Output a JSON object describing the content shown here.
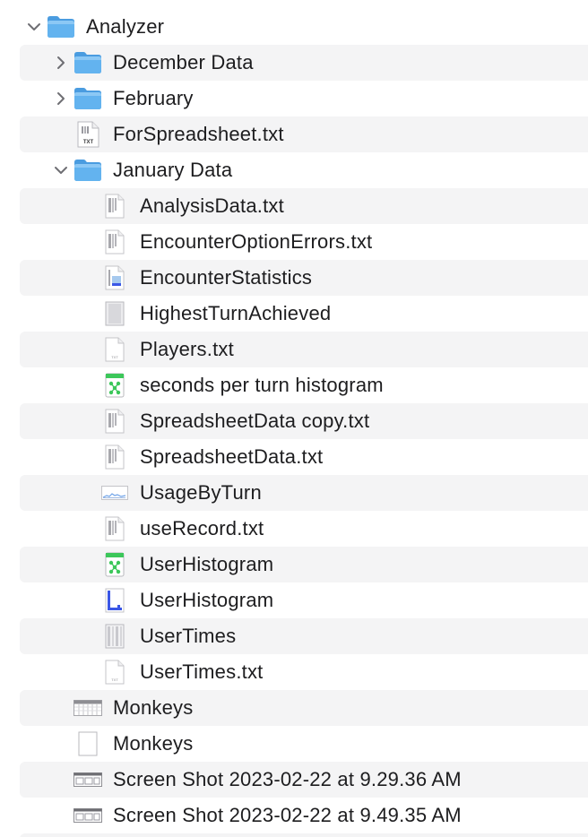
{
  "colors": {
    "folder": "#63b3ef",
    "folder_tab": "#4a9ce0",
    "stripe": "#f4f4f5",
    "text": "#1d1d1f",
    "chevron": "#6e6e73",
    "numbers_green": "#3cc75a",
    "chart_blue": "#3b57e6"
  },
  "items": [
    {
      "label": "Analyzer",
      "level": 0,
      "kind": "folder",
      "disclosure": "expanded",
      "icon": "folder-icon"
    },
    {
      "label": "December Data",
      "level": 1,
      "kind": "folder",
      "disclosure": "collapsed",
      "icon": "folder-icon"
    },
    {
      "label": "February",
      "level": 1,
      "kind": "folder",
      "disclosure": "collapsed",
      "icon": "folder-icon"
    },
    {
      "label": "ForSpreadsheet.txt",
      "level": 1,
      "kind": "txt",
      "disclosure": "none",
      "icon": "txt-file-icon",
      "badge": "TXT"
    },
    {
      "label": "January Data",
      "level": 1,
      "kind": "folder",
      "disclosure": "expanded",
      "icon": "folder-icon"
    },
    {
      "label": "AnalysisData.txt",
      "level": 2,
      "kind": "txt-preview",
      "disclosure": "none",
      "icon": "txt-file-icon"
    },
    {
      "label": "EncounterOptionErrors.txt",
      "level": 2,
      "kind": "txt-preview",
      "disclosure": "none",
      "icon": "txt-file-icon"
    },
    {
      "label": "EncounterStatistics",
      "level": 2,
      "kind": "doc-chart",
      "disclosure": "none",
      "icon": "chart-document-icon"
    },
    {
      "label": "HighestTurnAchieved",
      "level": 2,
      "kind": "doc-gray",
      "disclosure": "none",
      "icon": "document-icon"
    },
    {
      "label": "Players.txt",
      "level": 2,
      "kind": "blank",
      "disclosure": "none",
      "icon": "txt-file-icon"
    },
    {
      "label": "seconds per turn histogram",
      "level": 2,
      "kind": "numbers",
      "disclosure": "none",
      "icon": "numbers-document-icon"
    },
    {
      "label": "SpreadsheetData copy.txt",
      "level": 2,
      "kind": "txt-preview",
      "disclosure": "none",
      "icon": "txt-file-icon"
    },
    {
      "label": "SpreadsheetData.txt",
      "level": 2,
      "kind": "txt-preview",
      "disclosure": "none",
      "icon": "txt-file-icon"
    },
    {
      "label": "UsageByTurn",
      "level": 2,
      "kind": "wide-chart",
      "disclosure": "none",
      "icon": "chart-thumbnail-icon"
    },
    {
      "label": "useRecord.txt",
      "level": 2,
      "kind": "txt-preview",
      "disclosure": "none",
      "icon": "txt-file-icon"
    },
    {
      "label": "UserHistogram",
      "level": 2,
      "kind": "numbers",
      "disclosure": "none",
      "icon": "numbers-document-icon"
    },
    {
      "label": "UserHistogram",
      "level": 2,
      "kind": "doc-bluechart",
      "disclosure": "none",
      "icon": "chart-document-icon"
    },
    {
      "label": "UserTimes",
      "level": 2,
      "kind": "doc-lines",
      "disclosure": "none",
      "icon": "document-icon"
    },
    {
      "label": "UserTimes.txt",
      "level": 2,
      "kind": "blank",
      "disclosure": "none",
      "icon": "txt-file-icon"
    },
    {
      "label": "Monkeys",
      "level": 1,
      "kind": "spreadsheet-wide",
      "disclosure": "none",
      "icon": "spreadsheet-thumbnail-icon"
    },
    {
      "label": "Monkeys",
      "level": 1,
      "kind": "blank-tall",
      "disclosure": "none",
      "icon": "document-icon"
    },
    {
      "label": "Screen Shot 2023-02-22 at 9.29.36 AM",
      "level": 1,
      "kind": "screenshot",
      "disclosure": "none",
      "icon": "screenshot-icon"
    },
    {
      "label": "Screen Shot 2023-02-22 at 9.49.35 AM",
      "level": 1,
      "kind": "screenshot",
      "disclosure": "none",
      "icon": "screenshot-icon"
    }
  ]
}
